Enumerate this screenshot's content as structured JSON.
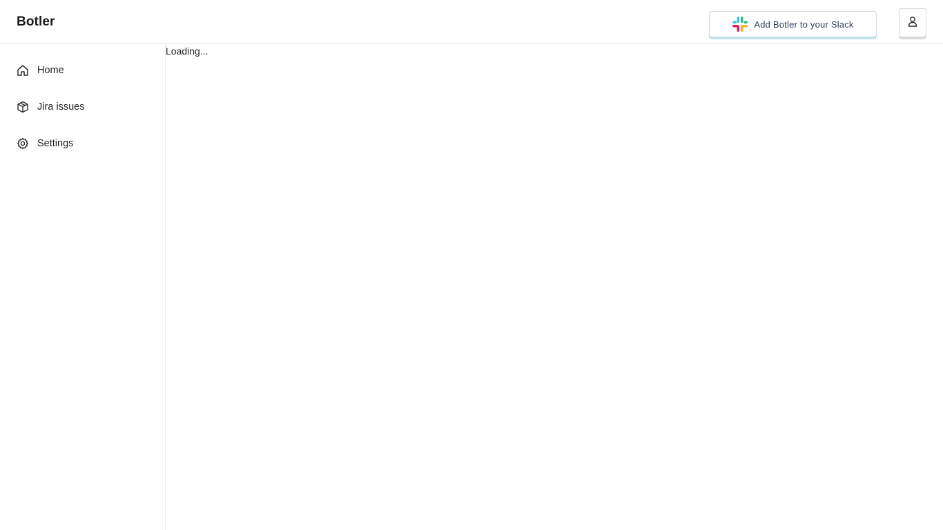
{
  "app": {
    "title": "Botler"
  },
  "header": {
    "slack_button_label": "Add Botler to your Slack",
    "slack_icon": "slack-logo-icon",
    "user_icon": "user-icon"
  },
  "sidebar": {
    "items": [
      {
        "label": "Home",
        "icon": "home-icon"
      },
      {
        "label": "Jira issues",
        "icon": "package-icon"
      },
      {
        "label": "Settings",
        "icon": "gear-icon"
      }
    ]
  },
  "main": {
    "status_text": "Loading..."
  },
  "colors": {
    "slack_button_shadow": "#bde3f2",
    "slack_green": "#2eb67d",
    "slack_blue": "#36c5f0",
    "slack_yellow": "#ecb22e",
    "slack_red": "#e01e5a"
  }
}
